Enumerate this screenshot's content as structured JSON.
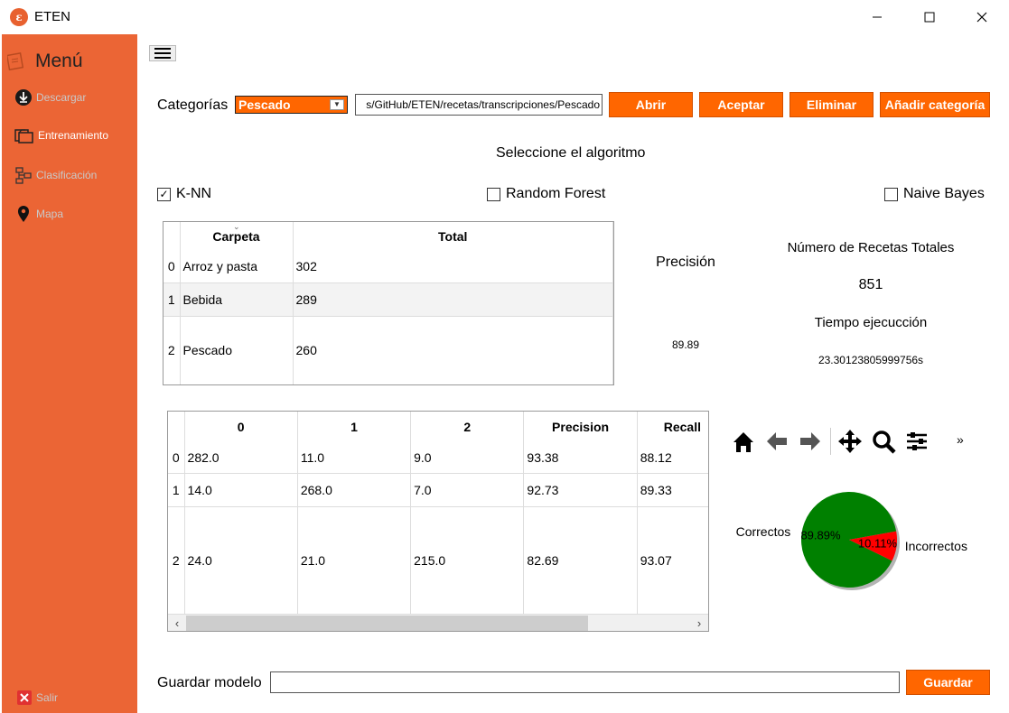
{
  "window": {
    "title": "ETEN",
    "icon_letter": "ɛ"
  },
  "sidebar": {
    "title": "Menú",
    "items": [
      {
        "label": "Descargar",
        "icon": "download-icon"
      },
      {
        "label": "Entrenamiento",
        "icon": "folders-icon"
      },
      {
        "label": "Clasificación",
        "icon": "network-icon"
      },
      {
        "label": "Mapa",
        "icon": "map-pin-icon"
      }
    ],
    "exit_label": "Salir"
  },
  "categories": {
    "label": "Categorías",
    "selected": "Pescado",
    "path": "s/GitHub/ETEN/recetas/transcripciones/Pescado",
    "buttons": {
      "open": "Abrir",
      "accept": "Aceptar",
      "delete": "Eliminar",
      "add": "Añadir categoría"
    }
  },
  "algorithm": {
    "title": "Seleccione el algoritmo",
    "options": [
      {
        "label": "K-NN",
        "checked": true
      },
      {
        "label": "Random Forest",
        "checked": false
      },
      {
        "label": "Naive Bayes",
        "checked": false
      }
    ]
  },
  "folders_table": {
    "columns": [
      "Carpeta",
      "Total"
    ],
    "rows": [
      {
        "idx": "0",
        "carpeta": "Arroz y pasta",
        "total": "302"
      },
      {
        "idx": "1",
        "carpeta": "Bebida",
        "total": "289"
      },
      {
        "idx": "2",
        "carpeta": "Pescado",
        "total": "260"
      }
    ]
  },
  "stats": {
    "precision_label": "Precisión",
    "precision_value": "89.89",
    "total_label": "Número de Recetas Totales",
    "total_value": "851",
    "time_label": "Tiempo ejecucción",
    "time_value": "23.30123805999756s"
  },
  "confusion_table": {
    "columns": [
      "0",
      "1",
      "2",
      "Precision",
      "Recall"
    ],
    "rows": [
      {
        "idx": "0",
        "cells": [
          "282.0",
          "11.0",
          "9.0",
          "93.38",
          "88.12"
        ]
      },
      {
        "idx": "1",
        "cells": [
          "14.0",
          "268.0",
          "7.0",
          "92.73",
          "89.33"
        ]
      },
      {
        "idx": "2",
        "cells": [
          "24.0",
          "21.0",
          "215.0",
          "82.69",
          "93.07"
        ]
      }
    ]
  },
  "toolbar": [
    "home-icon",
    "back-arrow-icon",
    "forward-arrow-icon",
    "pan-icon",
    "zoom-icon",
    "configure-icon",
    "more-icon"
  ],
  "toolbar_more": "»",
  "chart_data": {
    "type": "pie",
    "labels": [
      "Correctos",
      "Incorrectos"
    ],
    "values": [
      89.89,
      10.11
    ],
    "value_labels": [
      "89.89%",
      "10.11%"
    ],
    "colors": [
      "#008000",
      "#ff0000"
    ]
  },
  "save": {
    "label": "Guardar modelo",
    "button": "Guardar",
    "value": ""
  }
}
